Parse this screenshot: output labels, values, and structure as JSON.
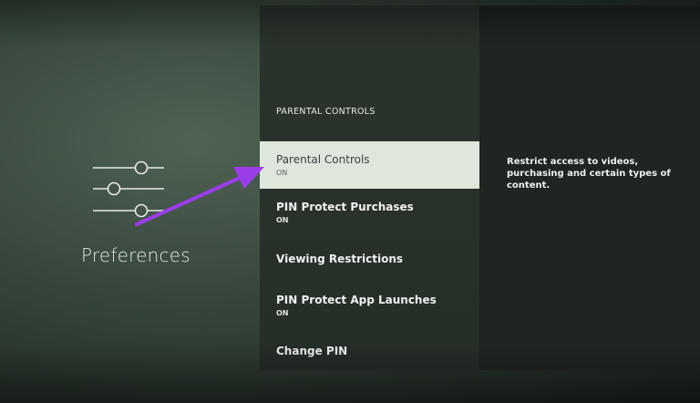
{
  "left_panel": {
    "icon": "sliders-icon",
    "label": "Preferences"
  },
  "menu": {
    "header": "PARENTAL CONTROLS",
    "items": [
      {
        "title": "Parental Controls",
        "status": "ON",
        "selected": true
      },
      {
        "title": "PIN Protect Purchases",
        "status": "ON",
        "selected": false
      },
      {
        "title": "Viewing Restrictions",
        "status": "",
        "selected": false
      },
      {
        "title": "PIN Protect App Launches",
        "status": "ON",
        "selected": false
      },
      {
        "title": "Change PIN",
        "status": "",
        "selected": false
      }
    ]
  },
  "description": {
    "text": "Restrict access to videos, purchasing and certain types of content."
  },
  "annotation": {
    "icon": "arrow-icon",
    "color": "#9b3dea"
  },
  "colors": {
    "selected_bg": "#dfe6dc",
    "menu_bg": "#2a332c",
    "arrow": "#9b3dea"
  }
}
